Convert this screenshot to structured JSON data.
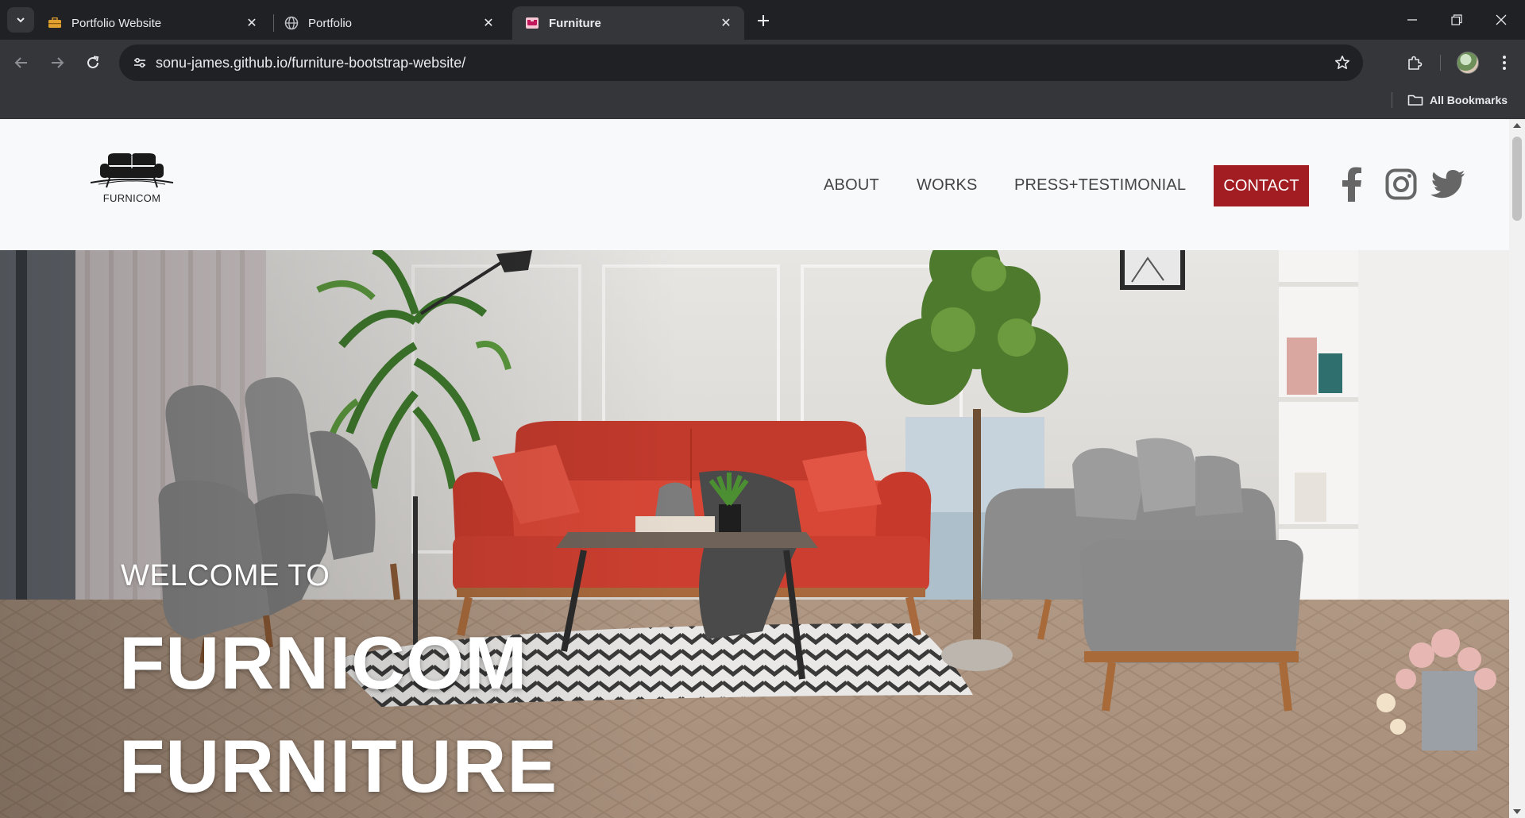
{
  "browser": {
    "tabs": [
      {
        "title": "Portfolio Website",
        "favicon": "briefcase-icon",
        "active": false
      },
      {
        "title": "Portfolio",
        "favicon": "globe-icon",
        "active": false
      },
      {
        "title": "Furniture",
        "favicon": "couch-favicon-icon",
        "active": true
      }
    ],
    "url": "sonu-james.github.io/furniture-bootstrap-website/",
    "bookmarks_label": "All Bookmarks"
  },
  "site": {
    "brand": "FURNICOM",
    "nav": {
      "about": "ABOUT",
      "works": "WORKS",
      "press": "PRESS+TESTIMONIAL",
      "contact": "CONTACT"
    },
    "social": [
      "facebook-icon",
      "instagram-icon",
      "twitter-icon"
    ],
    "accent_color": "#a11d22",
    "hero": {
      "subtitle": "WELCOME TO",
      "title_line1": "FURNICOM",
      "title_line2": "FURNITURE"
    }
  }
}
